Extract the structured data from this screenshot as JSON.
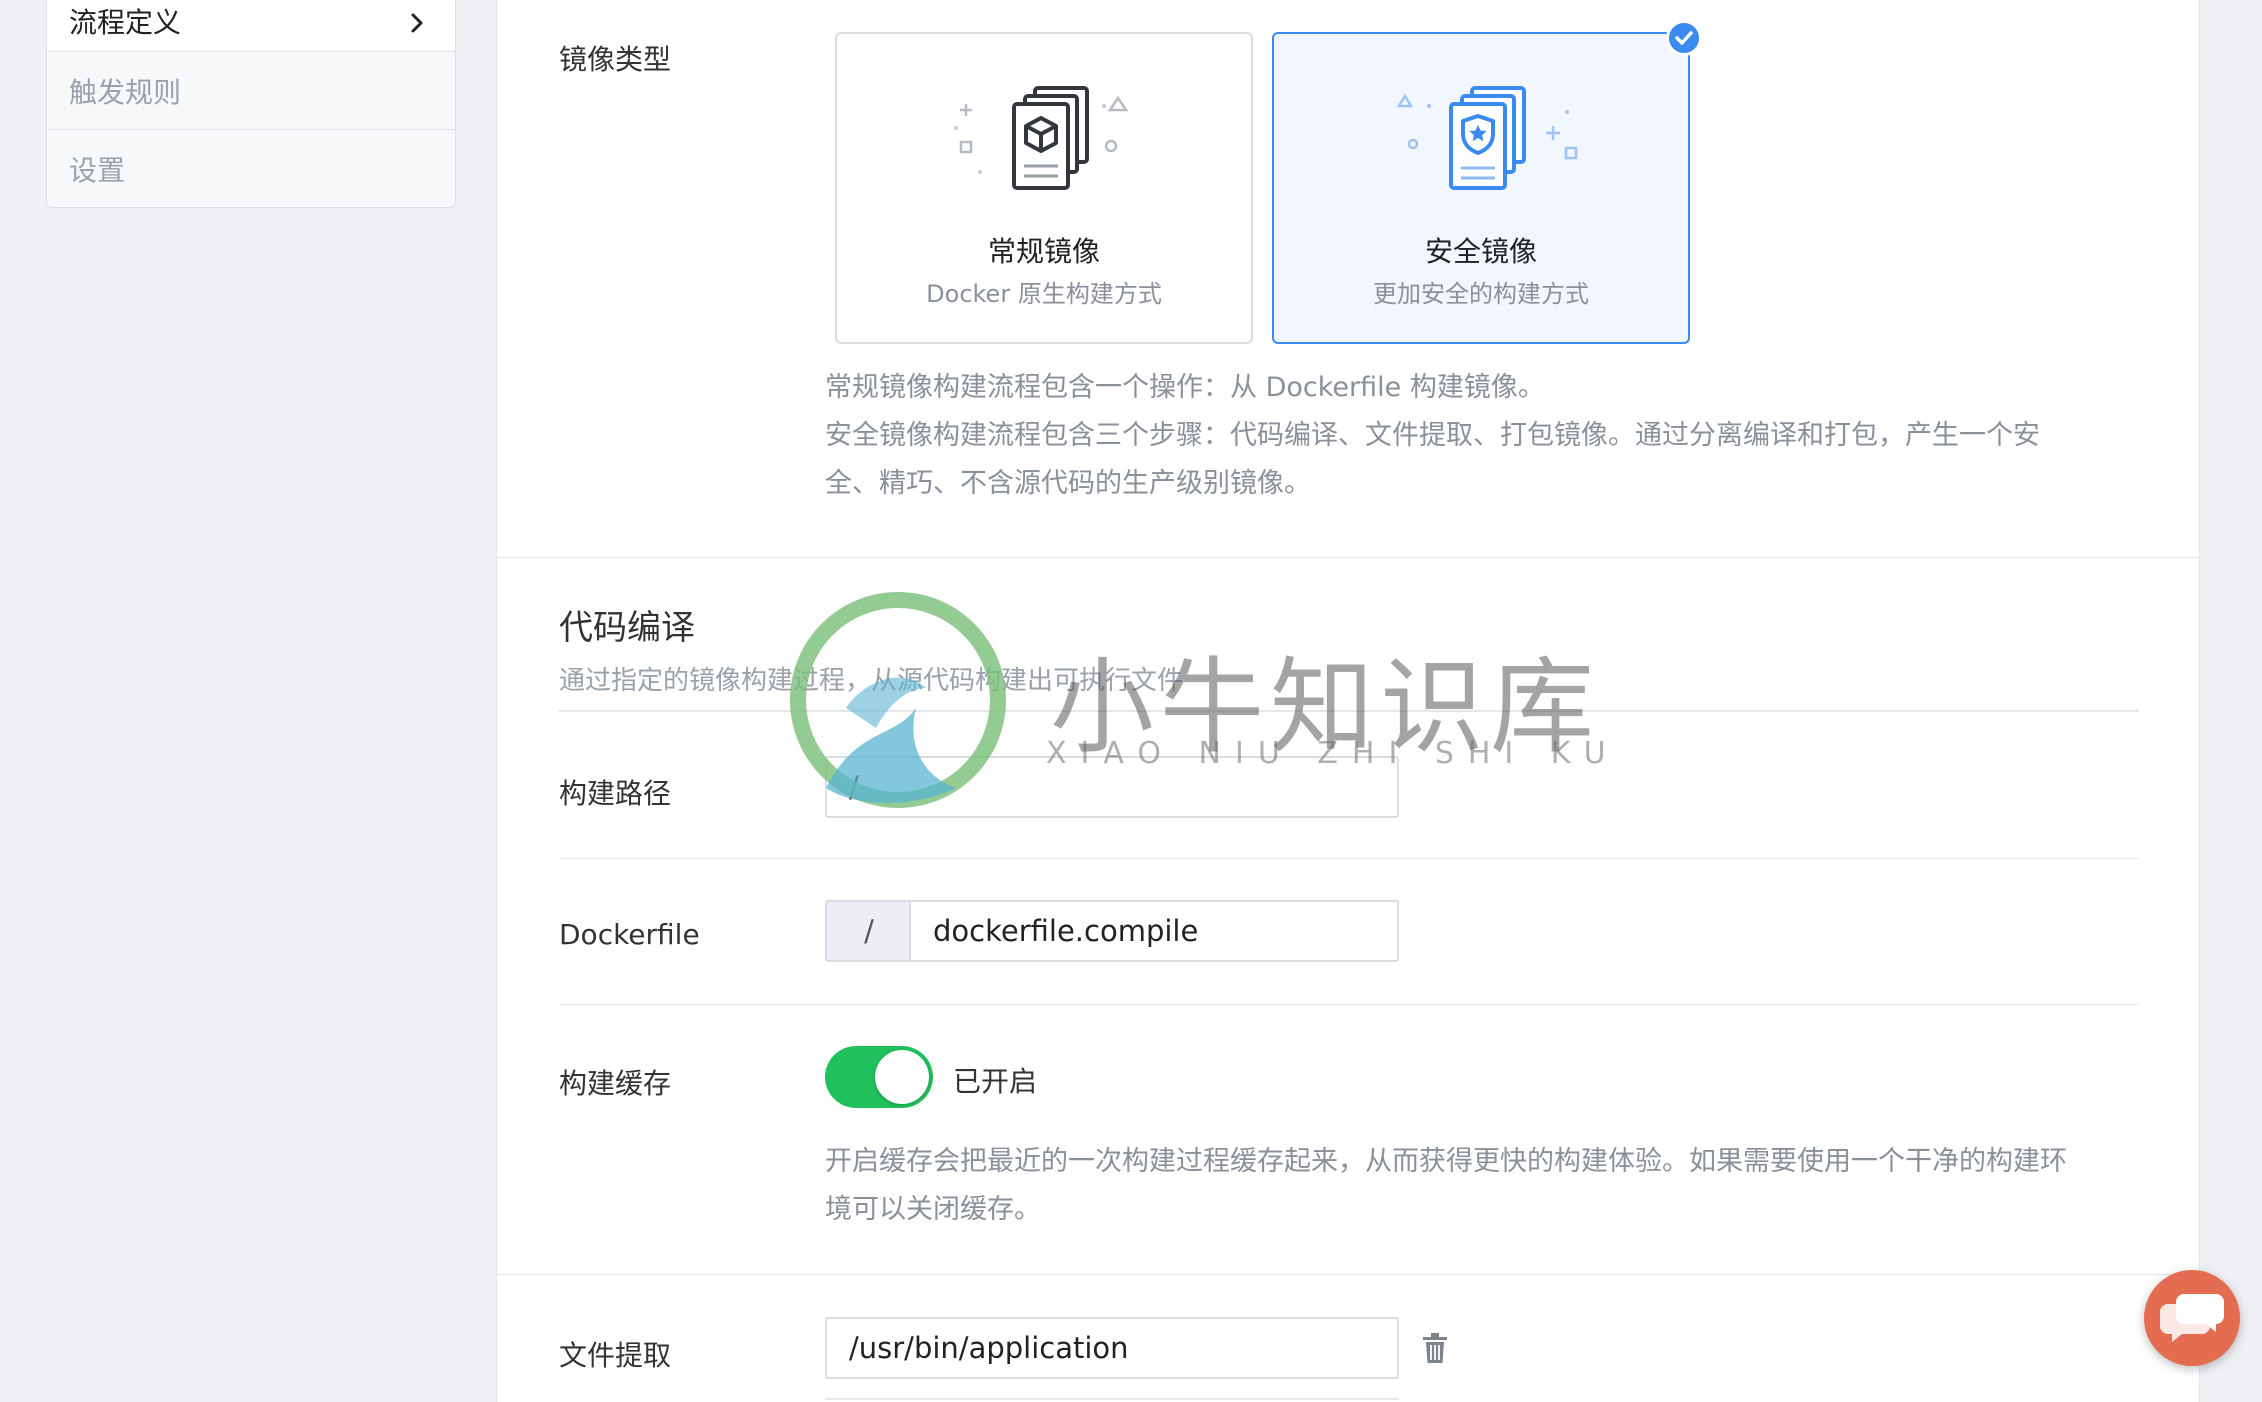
{
  "sidebar": {
    "items": [
      {
        "label": "流程定义"
      },
      {
        "label": "触发规则"
      },
      {
        "label": "设置"
      }
    ]
  },
  "image_type": {
    "label": "镜像类型",
    "cards": [
      {
        "title": "常规镜像",
        "subtitle": "Docker 原生构建方式",
        "icon": "cube-document-stack-icon"
      },
      {
        "title": "安全镜像",
        "subtitle": "更加安全的构建方式",
        "icon": "shield-document-stack-icon"
      }
    ],
    "selected": "安全镜像",
    "help_line1": "常规镜像构建流程包含一个操作：从 Dockerfile 构建镜像。",
    "help_line2": "安全镜像构建流程包含三个步骤：代码编译、文件提取、打包镜像。通过分离编译和打包，产生一个安",
    "help_line3": "全、精巧、不含源代码的生产级别镜像。"
  },
  "compile": {
    "title": "代码编译",
    "description": "通过指定的镜像构建过程，从源代码构建出可执行文件",
    "build_path": {
      "label": "构建路径",
      "value": "/"
    },
    "dockerfile": {
      "label": "Dockerfile",
      "prefix": "/",
      "value": "dockerfile.compile"
    },
    "cache": {
      "label": "构建缓存",
      "state_text": "已开启",
      "enabled": true,
      "help_line1": "开启缓存会把最近的一次构建过程缓存起来，从而获得更快的构建体验。如果需要使用一个干净的构建环",
      "help_line2": "境可以关闭缓存。"
    }
  },
  "extract": {
    "label": "文件提取",
    "value": "/usr/bin/application",
    "delete_icon": "trash-icon"
  },
  "watermark": {
    "text": "小牛知识库",
    "subtext": "XIAO NIU ZHI SHI KU"
  },
  "colors": {
    "accent": "#3b8af0",
    "toggle_on": "#20c05c",
    "chat": "#e46c50"
  }
}
